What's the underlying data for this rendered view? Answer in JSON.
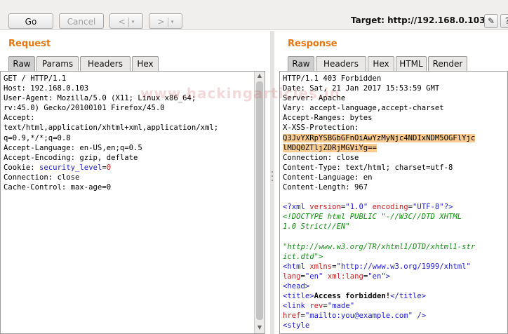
{
  "toolbar": {
    "go_label": "Go",
    "cancel_label": "Cancel",
    "back_label": "<",
    "forward_label": ">",
    "dropdown_glyph": "▾",
    "target_text": "Target: http://192.168.0.103",
    "edit_icon_glyph": "✎",
    "help_icon_glyph": "?"
  },
  "request": {
    "title": "Request",
    "tabs": [
      {
        "label": "Raw",
        "active": true
      },
      {
        "label": "Params",
        "active": false
      },
      {
        "label": "Headers",
        "active": false
      },
      {
        "label": "Hex",
        "active": false
      }
    ],
    "lines": [
      [
        {
          "t": "GET / HTTP/1.1"
        }
      ],
      [
        {
          "t": "Host: 192.168.0.103"
        }
      ],
      [
        {
          "t": "User-Agent: Mozilla/5.0 (X11; Linux x86_64;"
        }
      ],
      [
        {
          "t": "rv:45.0) Gecko/20100101 Firefox/45.0"
        }
      ],
      [
        {
          "t": "Accept:"
        }
      ],
      [
        {
          "t": "text/html,application/xhtml+xml,application/xml;"
        }
      ],
      [
        {
          "t": "q=0.9,*/*;q=0.8"
        }
      ],
      [
        {
          "t": "Accept-Language: en-US,en;q=0.5"
        }
      ],
      [
        {
          "t": "Accept-Encoding: gzip, deflate"
        }
      ],
      [
        {
          "t": "Cookie: "
        },
        {
          "t": "security_level",
          "c": "blue"
        },
        {
          "t": "="
        },
        {
          "t": "0",
          "c": "red"
        }
      ],
      [
        {
          "t": "Connection: close"
        }
      ],
      [
        {
          "t": "Cache-Control: max-age=0"
        }
      ]
    ]
  },
  "response": {
    "title": "Response",
    "tabs": [
      {
        "label": "Raw",
        "active": true
      },
      {
        "label": "Headers",
        "active": false
      },
      {
        "label": "Hex",
        "active": false
      },
      {
        "label": "HTML",
        "active": false
      },
      {
        "label": "Render",
        "active": false
      }
    ],
    "lines": [
      [
        {
          "t": "HTTP/1.1 403 Forbidden"
        }
      ],
      [
        {
          "t": "Date: Sat, 21 Jan 2017 15:53:59 GMT"
        }
      ],
      [
        {
          "t": "Server: Apache"
        }
      ],
      [
        {
          "t": "Vary: accept-language,accept-charset"
        }
      ],
      [
        {
          "t": "Accept-Ranges: bytes"
        }
      ],
      [
        {
          "t": "X-XSS-Protection:"
        }
      ],
      [
        {
          "t": "Q3JvYXRpYSBGbGFnOiAwYzMyNjc4NDIxNDM5OGFlYjc",
          "c": "hl"
        }
      ],
      [
        {
          "t": "lMDQ0ZTljZDRjMGViYg==",
          "c": "hl"
        }
      ],
      [
        {
          "t": "Connection: close"
        }
      ],
      [
        {
          "t": "Content-Type: text/html; charset=utf-8"
        }
      ],
      [
        {
          "t": "Content-Language: en"
        }
      ],
      [
        {
          "t": "Content-Length: 967"
        }
      ],
      [
        {
          "t": ""
        }
      ],
      [
        {
          "t": "<?xml ",
          "c": "blue"
        },
        {
          "t": "version",
          "c": "red"
        },
        {
          "t": "="
        },
        {
          "t": "\"1.0\"",
          "c": "blue"
        },
        {
          "t": " "
        },
        {
          "t": "encoding",
          "c": "red"
        },
        {
          "t": "="
        },
        {
          "t": "\"UTF-8\"",
          "c": "blue"
        },
        {
          "t": "?>",
          "c": "blue"
        }
      ],
      [
        {
          "t": "<!DOCTYPE html PUBLIC \"-//W3C//DTD XHTML",
          "c": "green ital"
        }
      ],
      [
        {
          "t": "1.0 Strict//EN\"",
          "c": "green ital"
        }
      ],
      [
        {
          "t": ""
        }
      ],
      [
        {
          "t": "\"http://www.w3.org/TR/xhtml1/DTD/xhtml1-str",
          "c": "green ital"
        }
      ],
      [
        {
          "t": "ict.dtd\">",
          "c": "green ital"
        }
      ],
      [
        {
          "t": "<html ",
          "c": "blue"
        },
        {
          "t": "xmlns",
          "c": "red"
        },
        {
          "t": "="
        },
        {
          "t": "\"http://www.w3.org/1999/xhtml\"",
          "c": "blue"
        }
      ],
      [
        {
          "t": "lang",
          "c": "red"
        },
        {
          "t": "="
        },
        {
          "t": "\"en\"",
          "c": "blue"
        },
        {
          "t": " "
        },
        {
          "t": "xml:lang",
          "c": "red"
        },
        {
          "t": "="
        },
        {
          "t": "\"en\"",
          "c": "blue"
        },
        {
          "t": ">",
          "c": "blue"
        }
      ],
      [
        {
          "t": "<head>",
          "c": "blue"
        }
      ],
      [
        {
          "t": "<title>",
          "c": "blue"
        },
        {
          "t": "Access forbidden!",
          "c": "bold"
        },
        {
          "t": "</title>",
          "c": "blue"
        }
      ],
      [
        {
          "t": "<link ",
          "c": "blue"
        },
        {
          "t": "rev",
          "c": "red"
        },
        {
          "t": "="
        },
        {
          "t": "\"made\"",
          "c": "blue"
        }
      ],
      [
        {
          "t": "href",
          "c": "red"
        },
        {
          "t": "="
        },
        {
          "t": "\"mailto:you@example.com\"",
          "c": "blue"
        },
        {
          "t": " />",
          "c": "blue"
        }
      ],
      [
        {
          "t": "<style",
          "c": "blue"
        }
      ]
    ]
  },
  "watermark": "www.hackingarticles.in"
}
